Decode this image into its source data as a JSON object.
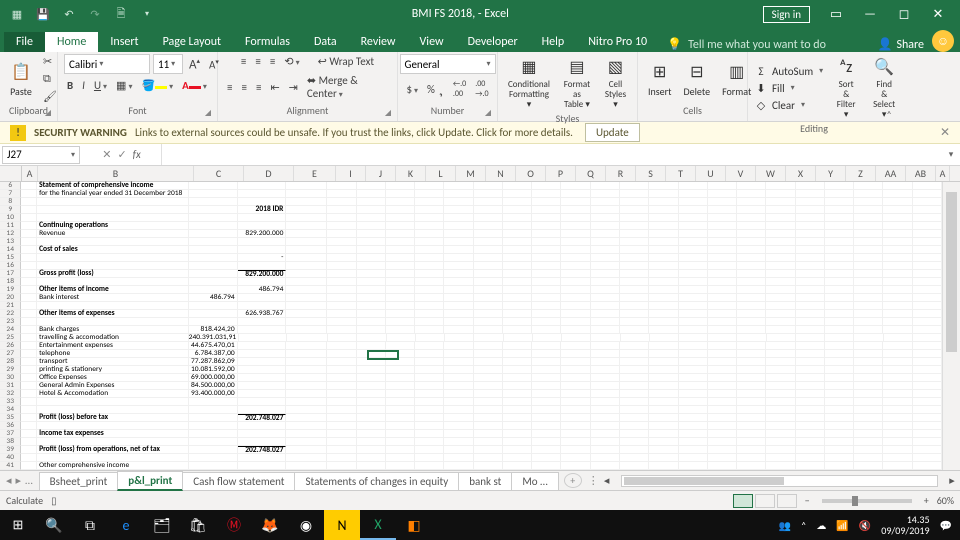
{
  "titlebar": {
    "title": "BMI FS 2018,  -  Excel",
    "signin": "Sign in"
  },
  "tabs": {
    "file": "File",
    "home": "Home",
    "insert": "Insert",
    "pagelayout": "Page Layout",
    "formulas": "Formulas",
    "data": "Data",
    "review": "Review",
    "view": "View",
    "developer": "Developer",
    "help": "Help",
    "nitro": "Nitro Pro 10",
    "tellme": "Tell me what you want to do",
    "share": "Share"
  },
  "ribbon": {
    "paste": "Paste",
    "clipboard": "Clipboard",
    "font_name": "Calibri",
    "font_size": "11",
    "font": "Font",
    "alignment": "Alignment",
    "wrap": "Wrap Text",
    "merge": "Merge & Center",
    "number": "Number",
    "number_fmt": "General",
    "styles": "Styles",
    "conditional": "Conditional Formatting",
    "formatas": "Format as Table",
    "cellstyles": "Cell Styles",
    "cells": "Cells",
    "insert": "Insert",
    "delete": "Delete",
    "format": "Format",
    "editing": "Editing",
    "autosum": "AutoSum",
    "fill": "Fill",
    "clear": "Clear",
    "sortfind": "Sort & Find & Filter",
    "select": "Select"
  },
  "security": {
    "title": "SECURITY WARNING",
    "msg": "Links to external sources could be unsafe. If you trust the links, click Update. Click for more details.",
    "btn": "Update"
  },
  "fbar": {
    "name": "J27",
    "fx": "fx",
    "val": ""
  },
  "cols": [
    "A",
    "B",
    "C",
    "D",
    "E",
    "I",
    "J",
    "K",
    "L",
    "M",
    "N",
    "O",
    "P",
    "Q",
    "R",
    "S",
    "T",
    "U",
    "V",
    "W",
    "X",
    "Y",
    "Z",
    "AA",
    "AB",
    "A"
  ],
  "rows": [
    {
      "n": 6,
      "b": "Statement of comprehensive income",
      "bold": true
    },
    {
      "n": 7,
      "b": "for the financial year ended 31 December 2018"
    },
    {
      "n": 8
    },
    {
      "n": 9,
      "d": "2018 IDR",
      "dbold": true,
      "dr": true
    },
    {
      "n": 10
    },
    {
      "n": 11,
      "b": "Continuing operations",
      "bold": true
    },
    {
      "n": 12,
      "b": "Revenue",
      "d": "829.200.000",
      "dr": true
    },
    {
      "n": 13
    },
    {
      "n": 14,
      "b": "Cost of sales",
      "bold": true
    },
    {
      "n": 15,
      "d": "-",
      "dr": true
    },
    {
      "n": 16
    },
    {
      "n": 17,
      "b": "Gross profit (loss)",
      "bold": true,
      "d": "829.200.000",
      "dr": true,
      "dbold": true,
      "dtop": true
    },
    {
      "n": 18
    },
    {
      "n": 19,
      "b": "Other items of income",
      "bold": true,
      "d": "486.794",
      "dr": true
    },
    {
      "n": 20,
      "b": "Bank interest",
      "c": "486.794",
      "cr": true
    },
    {
      "n": 21
    },
    {
      "n": 22,
      "b": "Other items of expenses",
      "bold": true,
      "d": "626.938.767",
      "dr": true
    },
    {
      "n": 23
    },
    {
      "n": 24,
      "b": "Bank charges",
      "c": "818.424,20",
      "cr": true
    },
    {
      "n": 25,
      "b": "travelling & accomodation",
      "c": "240.391.031,91",
      "cr": true
    },
    {
      "n": 26,
      "b": "Entertainment expenses",
      "c": "44.675.470,01",
      "cr": true
    },
    {
      "n": 27,
      "b": "telephone",
      "c": "6.784.387,00",
      "cr": true
    },
    {
      "n": 28,
      "b": "transport",
      "c": "77.287.862,09",
      "cr": true
    },
    {
      "n": 29,
      "b": "printing & stationery",
      "c": "10.081.592,00",
      "cr": true
    },
    {
      "n": 30,
      "b": "Office Expenses",
      "c": "69.000.000,00",
      "cr": true
    },
    {
      "n": 31,
      "b": "General Admin Expenses",
      "c": "84.500.000,00",
      "cr": true
    },
    {
      "n": 32,
      "b": "Hotel & Accomodation",
      "c": "93.400.000,00",
      "cr": true
    },
    {
      "n": 33
    },
    {
      "n": 34
    },
    {
      "n": 35,
      "b": "Profit (loss) before tax",
      "bold": true,
      "d": "202.748.027",
      "dr": true,
      "dbold": true,
      "dtop": true
    },
    {
      "n": 36
    },
    {
      "n": 37,
      "b": "Income tax expenses",
      "bold": true
    },
    {
      "n": 38
    },
    {
      "n": 39,
      "b": "Profit (loss) from operations, net of tax",
      "bold": true,
      "d": "202.748.027",
      "dr": true,
      "dbold": true,
      "dtop": true
    },
    {
      "n": 40
    },
    {
      "n": 41,
      "b": "Other comprehensive income"
    }
  ],
  "sheets": {
    "s1": "Bsheet_print",
    "s2": "p&l_print",
    "s3": "Cash flow statement",
    "s4": "Statements of changes in equity",
    "s5": "bank st",
    "s6": "Mo"
  },
  "status": {
    "mode": "Calculate",
    "zoom": "60%"
  },
  "clock": {
    "time": "14.35",
    "date": "09/09/2019"
  }
}
